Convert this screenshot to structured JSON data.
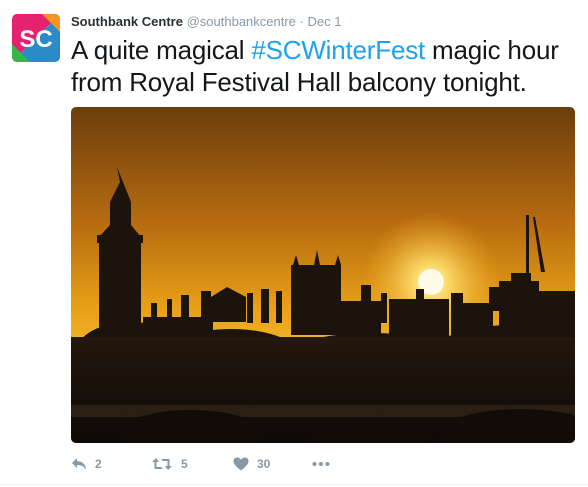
{
  "tweet": {
    "account": {
      "avatar_text": "SC",
      "name": "Southbank Centre",
      "handle": "@southbankcentre",
      "separator": "·",
      "date": "Dec 1"
    },
    "text_before": "A quite magical ",
    "hashtag": "#SCWinterFest",
    "text_after": " magic hour from Royal Festival Hall balcony tonight.",
    "media": {
      "description_icon": "photo",
      "colors": {
        "sky_top": "#7a4a10",
        "sky_mid": "#e8a018",
        "sun": "#fff4c0",
        "silhouette": "#1a120c"
      }
    },
    "actions": {
      "reply": {
        "icon": "reply-icon",
        "count": "2"
      },
      "retweet": {
        "icon": "retweet-icon",
        "count": "5"
      },
      "like": {
        "icon": "heart-icon",
        "count": "30"
      },
      "more": {
        "icon": "more-icon"
      }
    },
    "colors": {
      "link": "#1da1f2",
      "muted": "#8899a6",
      "text": "#14171a"
    }
  }
}
